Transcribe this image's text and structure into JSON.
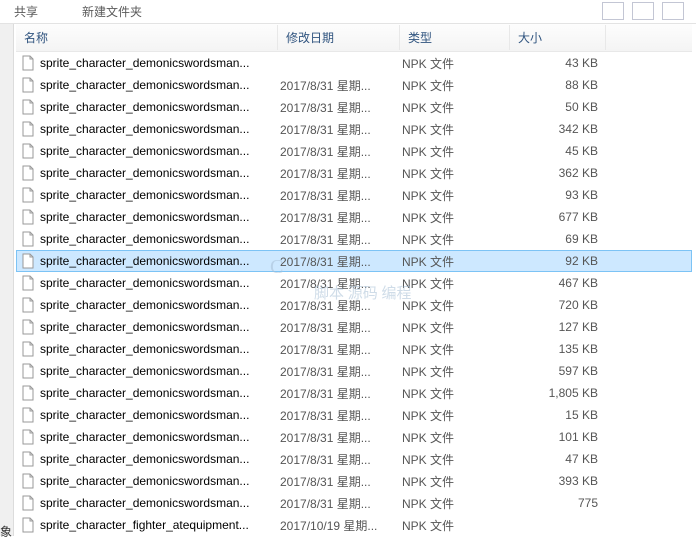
{
  "toolbar": {
    "share_label": "共享",
    "new_folder_label": "新建文件夹"
  },
  "columns": {
    "name": "名称",
    "date": "修改日期",
    "type": "类型",
    "size": "大小"
  },
  "watermark": {
    "line1": "C",
    "line2": "脚本  源码  编程"
  },
  "corner": "象",
  "selected_index": 9,
  "files": [
    {
      "name": "sprite_character_demonicswordsman...",
      "date": "",
      "type": "NPK 文件",
      "size": "43 KB"
    },
    {
      "name": "sprite_character_demonicswordsman...",
      "date": "2017/8/31 星期...",
      "type": "NPK 文件",
      "size": "88 KB"
    },
    {
      "name": "sprite_character_demonicswordsman...",
      "date": "2017/8/31 星期...",
      "type": "NPK 文件",
      "size": "50 KB"
    },
    {
      "name": "sprite_character_demonicswordsman...",
      "date": "2017/8/31 星期...",
      "type": "NPK 文件",
      "size": "342 KB"
    },
    {
      "name": "sprite_character_demonicswordsman...",
      "date": "2017/8/31 星期...",
      "type": "NPK 文件",
      "size": "45 KB"
    },
    {
      "name": "sprite_character_demonicswordsman...",
      "date": "2017/8/31 星期...",
      "type": "NPK 文件",
      "size": "362 KB"
    },
    {
      "name": "sprite_character_demonicswordsman...",
      "date": "2017/8/31 星期...",
      "type": "NPK 文件",
      "size": "93 KB"
    },
    {
      "name": "sprite_character_demonicswordsman...",
      "date": "2017/8/31 星期...",
      "type": "NPK 文件",
      "size": "677 KB"
    },
    {
      "name": "sprite_character_demonicswordsman...",
      "date": "2017/8/31 星期...",
      "type": "NPK 文件",
      "size": "69 KB"
    },
    {
      "name": "sprite_character_demonicswordsman...",
      "date": "2017/8/31 星期...",
      "type": "NPK 文件",
      "size": "92 KB"
    },
    {
      "name": "sprite_character_demonicswordsman...",
      "date": "2017/8/31 星期...",
      "type": "NPK 文件",
      "size": "467 KB"
    },
    {
      "name": "sprite_character_demonicswordsman...",
      "date": "2017/8/31 星期...",
      "type": "NPK 文件",
      "size": "720 KB"
    },
    {
      "name": "sprite_character_demonicswordsman...",
      "date": "2017/8/31 星期...",
      "type": "NPK 文件",
      "size": "127 KB"
    },
    {
      "name": "sprite_character_demonicswordsman...",
      "date": "2017/8/31 星期...",
      "type": "NPK 文件",
      "size": "135 KB"
    },
    {
      "name": "sprite_character_demonicswordsman...",
      "date": "2017/8/31 星期...",
      "type": "NPK 文件",
      "size": "597 KB"
    },
    {
      "name": "sprite_character_demonicswordsman...",
      "date": "2017/8/31 星期...",
      "type": "NPK 文件",
      "size": "1,805 KB"
    },
    {
      "name": "sprite_character_demonicswordsman...",
      "date": "2017/8/31 星期...",
      "type": "NPK 文件",
      "size": "15 KB"
    },
    {
      "name": "sprite_character_demonicswordsman...",
      "date": "2017/8/31 星期...",
      "type": "NPK 文件",
      "size": "101 KB"
    },
    {
      "name": "sprite_character_demonicswordsman...",
      "date": "2017/8/31 星期...",
      "type": "NPK 文件",
      "size": "47 KB"
    },
    {
      "name": "sprite_character_demonicswordsman...",
      "date": "2017/8/31 星期...",
      "type": "NPK 文件",
      "size": "393 KB"
    },
    {
      "name": "sprite_character_demonicswordsman...",
      "date": "2017/8/31 星期...",
      "type": "NPK 文件",
      "size": "775"
    },
    {
      "name": "sprite_character_fighter_atequipment...",
      "date": "2017/10/19 星期...",
      "type": "NPK 文件",
      "size": ""
    }
  ]
}
